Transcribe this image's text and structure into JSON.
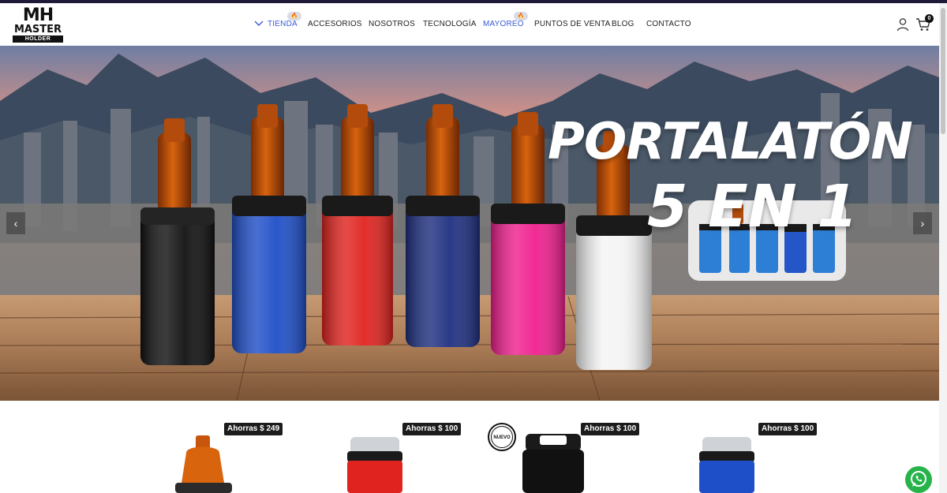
{
  "brand": {
    "logo_top": "MH",
    "logo_middle": "MASTER",
    "logo_bottom": "HOLDER"
  },
  "nav": {
    "items": [
      {
        "label": "TIENDA",
        "active": true,
        "hot": true
      },
      {
        "label": "ACCESORIOS",
        "active": false,
        "hot": false
      },
      {
        "label": "NOSOTROS",
        "active": false,
        "hot": false
      },
      {
        "label": "TECNOLOGÍA",
        "active": false,
        "hot": false
      },
      {
        "label": "MAYOREO",
        "active": true,
        "hot": true
      },
      {
        "label": "PUNTOS DE VENTA",
        "active": false,
        "hot": false
      },
      {
        "label": "BLOG",
        "active": false,
        "hot": false
      },
      {
        "label": "CONTACTO",
        "active": false,
        "hot": false
      }
    ],
    "hot_icon": "fire-icon"
  },
  "header": {
    "account_icon": "user-icon",
    "cart_icon": "cart-icon",
    "cart_count": "0"
  },
  "hero": {
    "title_line1": "PORTALATÓN",
    "title_line2": "5 EN 1",
    "prev_icon": "chevron-left-icon",
    "next_icon": "chevron-right-icon",
    "prev_symbol": "‹",
    "next_symbol": "›",
    "holder_colors": [
      "#111111",
      "#1f4fc8",
      "#e0231f",
      "#1e2f80",
      "#f0208f",
      "#f4f4f4"
    ]
  },
  "products": [
    {
      "badge": "Ahorras $ 249",
      "is_new": false
    },
    {
      "badge": "Ahorras $ 100",
      "is_new": false
    },
    {
      "badge": "Ahorras $ 100",
      "is_new": true,
      "new_label": "NUEVO"
    },
    {
      "badge": "Ahorras $ 100",
      "is_new": false
    }
  ],
  "colors": {
    "accent": "#3a5bd9",
    "topbar": "#1e1b3a",
    "whatsapp": "#25b34a"
  },
  "floating": {
    "whatsapp_icon": "whatsapp-icon"
  }
}
